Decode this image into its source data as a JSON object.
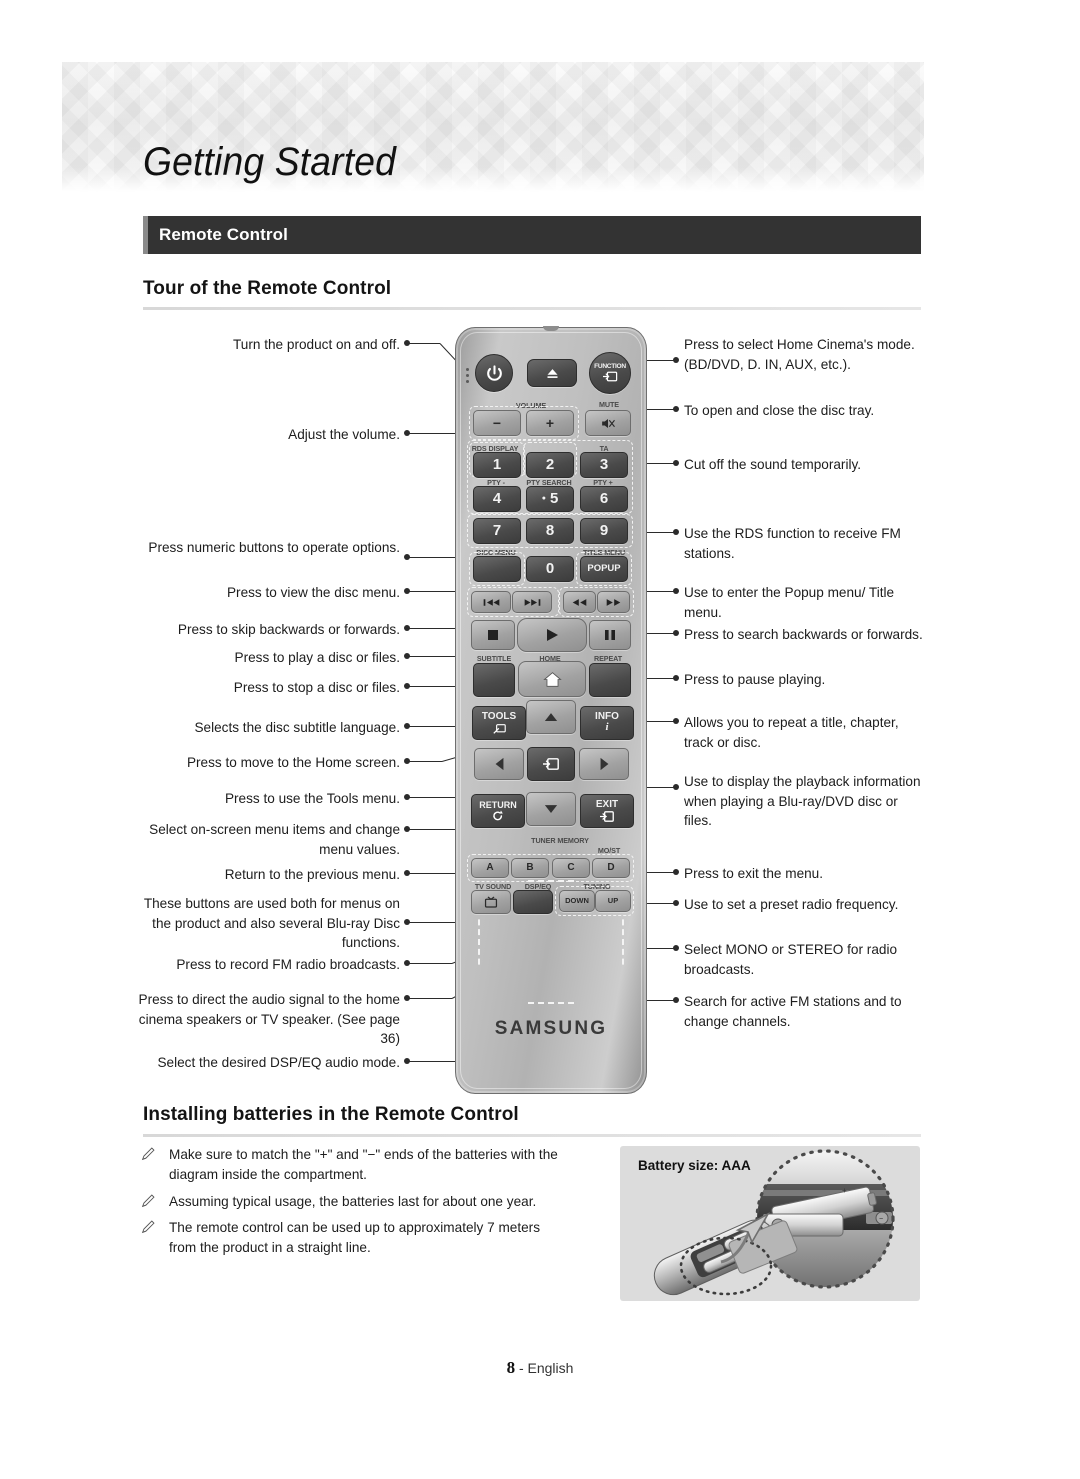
{
  "header": {
    "chapter_title": "Getting Started",
    "section_banner": "Remote Control"
  },
  "sections": {
    "tour_heading": "Tour of the Remote Control",
    "battery_heading": "Installing batteries in the Remote Control"
  },
  "callouts_left": [
    {
      "id": "power",
      "text": "Turn the product on and off."
    },
    {
      "id": "volume",
      "text": "Adjust the volume."
    },
    {
      "id": "numeric",
      "text": "Press numeric buttons to operate options."
    },
    {
      "id": "disc-menu",
      "text": "Press to view the disc menu."
    },
    {
      "id": "skip",
      "text": "Press to skip backwards or forwards."
    },
    {
      "id": "play",
      "text": "Press to play a disc or files."
    },
    {
      "id": "stop",
      "text": "Press to stop a disc or files."
    },
    {
      "id": "subtitle",
      "text": "Selects the disc subtitle language."
    },
    {
      "id": "home",
      "text": "Press to move to the Home screen."
    },
    {
      "id": "tools",
      "text": "Press to use the Tools menu."
    },
    {
      "id": "arrows",
      "text": "Select on-screen menu items and change menu values."
    },
    {
      "id": "return",
      "text": "Return to the previous menu."
    },
    {
      "id": "color-buttons",
      "text": "These buttons are used both for menus on the product and also several Blu-ray Disc functions."
    },
    {
      "id": "record-fm",
      "text": "Press to record FM radio broadcasts."
    },
    {
      "id": "tv-sound",
      "text": "Press to direct the audio signal to the home cinema speakers or TV speaker. (See page 36)"
    },
    {
      "id": "dsp-eq",
      "text": "Select the desired DSP/EQ audio mode."
    }
  ],
  "callouts_right": [
    {
      "id": "function",
      "text": "Press to select Home Cinema's mode. (BD/DVD, D. IN, AUX, etc.)."
    },
    {
      "id": "eject",
      "text": "To open and close the disc tray."
    },
    {
      "id": "mute",
      "text": "Cut off the sound temporarily."
    },
    {
      "id": "rds",
      "text": "Use the RDS function to receive FM stations."
    },
    {
      "id": "popup",
      "text": "Use to enter the Popup menu/ Title menu."
    },
    {
      "id": "search",
      "text": "Press to search backwards or forwards."
    },
    {
      "id": "pause",
      "text": "Press to pause playing."
    },
    {
      "id": "repeat",
      "text": "Allows you to repeat a title, chapter, track or disc."
    },
    {
      "id": "info",
      "text": "Use to display the playback information when playing a Blu-ray/DVD disc or files."
    },
    {
      "id": "exit",
      "text": "Press to exit the menu."
    },
    {
      "id": "tuner-mem",
      "text": "Use to set a preset radio frequency."
    },
    {
      "id": "mo-st",
      "text": "Select MONO or STEREO for radio broadcasts."
    },
    {
      "id": "tuning",
      "text": "Search for active FM stations and to change channels."
    }
  ],
  "remote": {
    "brand": "SAMSUNG",
    "buttons": {
      "power": "power-icon",
      "eject": "eject-icon",
      "function": "FUNCTION",
      "volume_minus": "−",
      "volume_plus": "+",
      "mute": "mute-icon",
      "num1": "1",
      "num2": "2",
      "num3": "3",
      "num4": "4",
      "num5": "5",
      "num6": "6",
      "num7": "7",
      "num8": "8",
      "num9": "9",
      "num0": "0",
      "popup": "POPUP",
      "disc_menu": "",
      "tools": "TOOLS",
      "info": "INFO",
      "return": "RETURN",
      "exit": "EXIT",
      "a": "A",
      "b": "B",
      "c": "C",
      "d": "D",
      "tuning_down": "DOWN",
      "tuning_up": "UP"
    },
    "labels": {
      "volume": "VOLUME",
      "mute": "MUTE",
      "rds_display": "RDS DISPLAY",
      "ta": "TA",
      "pty_minus": "PTY -",
      "pty_search": "PTY SEARCH",
      "pty_plus": "PTY +",
      "disc_menu": "DISC MENU",
      "title_menu": "TITLE MENU",
      "subtitle": "SUBTITLE",
      "home": "HOME",
      "repeat": "REPEAT",
      "tuner_memory": "TUNER MEMORY",
      "mo_st": "MO/ST",
      "tv_sound": "TV SOUND",
      "dsp_eq": "DSP/EQ",
      "tuning": "TUNING"
    }
  },
  "battery_notes": [
    "Make sure to match the \"+\" and \"−\" ends of the batteries with the diagram inside the compartment.",
    "Assuming typical usage, the batteries last for about one year.",
    "The remote control can be used up to approximately 7 meters from the product in a straight line."
  ],
  "battery_box": {
    "size_label": "Battery size: AAA"
  },
  "footer": {
    "page_number": "8",
    "language": "- English"
  },
  "colors": {
    "banner_bg": "#333333",
    "banner_accent": "#8a8a8a",
    "text": "#1d1d1d",
    "batt_box_bg": "#dcdcdc"
  }
}
